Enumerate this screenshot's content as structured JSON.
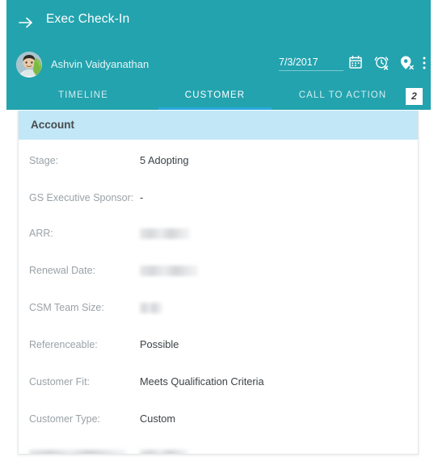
{
  "header": {
    "back_icon": "arrow-right-icon",
    "title": "Exec Check-In",
    "user_name": "Ashvin Vaidyanathan",
    "date_value": "7/3/2017",
    "icons": [
      {
        "name": "calendar-icon"
      },
      {
        "name": "alarm-off-icon"
      },
      {
        "name": "pin-off-icon"
      },
      {
        "name": "more-vertical-icon"
      }
    ],
    "teal_color": "#23a3ae",
    "accent_underline_color": "#2aa9dd"
  },
  "tabs": [
    {
      "label": "TIMELINE",
      "active": false
    },
    {
      "label": "CUSTOMER",
      "active": true
    },
    {
      "label": "CALL TO ACTION",
      "active": false
    }
  ],
  "tab_badge": "2",
  "card": {
    "header_title": "Account",
    "header_color": "#c2e7f6",
    "fields": [
      {
        "label": "Stage:",
        "value": "5 Adopting",
        "redacted": false
      },
      {
        "label": "GS Executive Sponsor:",
        "value": "-",
        "redacted": false
      },
      {
        "label": "ARR:",
        "value": "",
        "redacted": true
      },
      {
        "label": "Renewal Date:",
        "value": "",
        "redacted": true
      },
      {
        "label": "CSM Team Size:",
        "value": "",
        "redacted": true
      },
      {
        "label": "Referenceable:",
        "value": "Possible",
        "redacted": false
      },
      {
        "label": "Customer Fit:",
        "value": "Meets Qualification Criteria",
        "redacted": false
      },
      {
        "label": "Customer Type:",
        "value": "Custom",
        "redacted": false
      },
      {
        "label": "",
        "value": "",
        "redacted": true
      }
    ]
  }
}
